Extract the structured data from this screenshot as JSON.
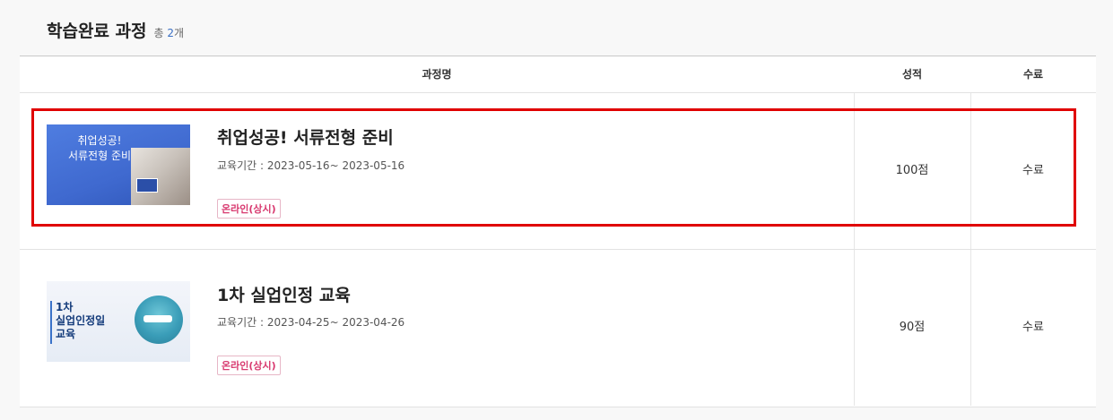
{
  "header": {
    "title": "학습완료 과정",
    "count_prefix": "총",
    "count_value": "2",
    "count_suffix": "개"
  },
  "table": {
    "columns": [
      "과정명",
      "성적",
      "수료"
    ],
    "rows": [
      {
        "thumbnail_text": [
          "취업성공!",
          "서류전형 준비"
        ],
        "title": "취업성공! 서류전형 준비",
        "period": "교육기간 : 2023-05-16~ 2023-05-16",
        "tag": "온라인(상시)",
        "score": "100점",
        "status": "수료"
      },
      {
        "thumbnail_text": [
          "1차",
          "실업인정일",
          "교육"
        ],
        "title": "1차 실업인정 교육",
        "period": "교육기간 : 2023-04-25~ 2023-04-26",
        "tag": "온라인(상시)",
        "score": "90점",
        "status": "수료"
      }
    ]
  },
  "colors": {
    "highlight": "#e00000",
    "tag": "#d8396f",
    "count_accent": "#3a6fc4"
  }
}
